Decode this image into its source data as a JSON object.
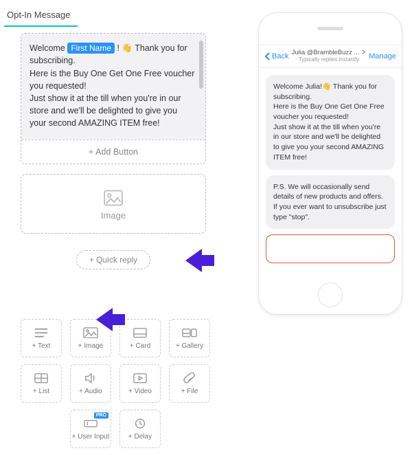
{
  "tab": {
    "label": "Opt-In Message"
  },
  "message": {
    "prefix": "Welcome ",
    "tag": "First Name",
    "after_tag": " ! 👋 Thank you for subscribing.",
    "line2": "Here is the Buy One Get One Free voucher you requested!",
    "line3": "Just show it at the till when you're in our store and we'll be delighted to give you your second AMAZING ITEM free!",
    "add_button": "+ Add Button"
  },
  "image_block": {
    "label": "Image"
  },
  "quick_reply": {
    "label": "+ Quick reply"
  },
  "tools": {
    "text": "+ Text",
    "image": "+ Image",
    "card": "+ Card",
    "gallery": "+ Gallery",
    "list": "+ List",
    "audio": "+ Audio",
    "video": "+ Video",
    "file": "+ File",
    "user_input": "+ User Input",
    "delay": "+ Delay",
    "pro": "PRO"
  },
  "phone": {
    "back": "Back",
    "title1": "Julia @BrambleBuzz ...",
    "title2": "Typically replies instantly",
    "manage": "Manage",
    "bubble1": "Welcome Julia!👋 Thank you for subscribing.\nHere is the Buy One Get One Free voucher you requested!\nJust show it at the till when you're in our store and we'll be delighted to give you your second AMAZING ITEM free!",
    "bubble2": "P.S. We will occasionally send details of new products and offers. If you ever want to unsubscribe just type \"stop\"."
  }
}
